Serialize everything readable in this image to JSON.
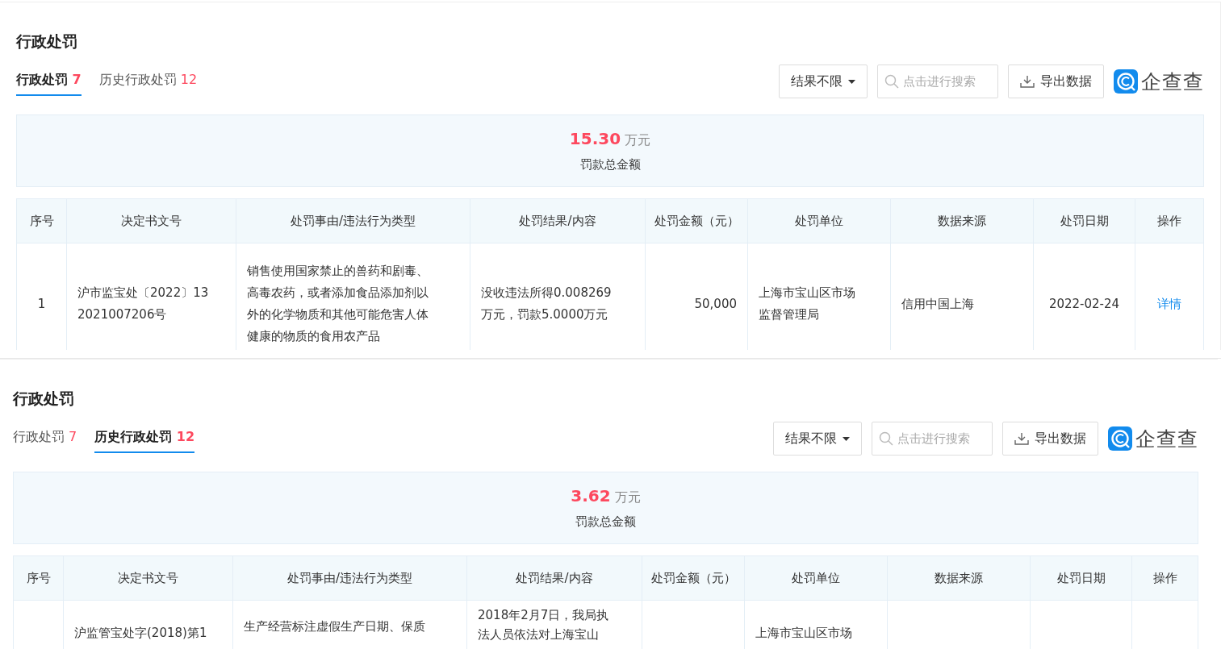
{
  "panels": [
    {
      "title": "行政处罚",
      "tabs": [
        {
          "label": "行政处罚",
          "count": "7",
          "selected": true
        },
        {
          "label": "历史行政处罚",
          "count": "12",
          "selected": false
        }
      ],
      "filter": {
        "label": "结果不限"
      },
      "search": {
        "placeholder": "点击进行搜索"
      },
      "export": {
        "label": "导出数据"
      },
      "logo": {
        "text": "企查查"
      },
      "summary": {
        "amount": "15.30",
        "unit": "万元",
        "label": "罚款总金额"
      },
      "columns": [
        "序号",
        "决定书文号",
        "处罚事由/违法行为类型",
        "处罚结果/内容",
        "处罚金额（元）",
        "处罚单位",
        "数据来源",
        "处罚日期",
        "操作"
      ],
      "rows": [
        {
          "seq": "1",
          "doc_no": "沪市监宝处〔2022〕132021007206号",
          "reason": "销售使用国家禁止的兽药和剧毒、高毒农药，或者添加食品添加剂以外的化学物质和其他可能危害人体健康的物质的食用农产品",
          "result": "没收违法所得0.008269万元，罚款5.0000万元",
          "amount": "50,000",
          "unit": "上海市宝山区市场监督管理局",
          "source": "信用中国上海",
          "date": "2022-02-24",
          "action": "详情"
        }
      ]
    },
    {
      "title": "行政处罚",
      "tabs": [
        {
          "label": "行政处罚",
          "count": "7",
          "selected": false
        },
        {
          "label": "历史行政处罚",
          "count": "12",
          "selected": true
        }
      ],
      "filter": {
        "label": "结果不限"
      },
      "search": {
        "placeholder": "点击进行搜索"
      },
      "export": {
        "label": "导出数据"
      },
      "logo": {
        "text": "企查查"
      },
      "summary": {
        "amount": "3.62",
        "unit": "万元",
        "label": "罚款总金额"
      },
      "columns": [
        "序号",
        "决定书文号",
        "处罚事由/违法行为类型",
        "处罚结果/内容",
        "处罚金额（元）",
        "处罚单位",
        "数据来源",
        "处罚日期",
        "操作"
      ],
      "rows": [
        {
          "doc_no": "沪监管宝处字(2018)第1",
          "reason": "生产经营标注虚假生产日期、保质",
          "result": "2018年2月7日，我局执法人员依法对上海宝山",
          "unit": "上海市宝山区市场"
        }
      ]
    }
  ]
}
